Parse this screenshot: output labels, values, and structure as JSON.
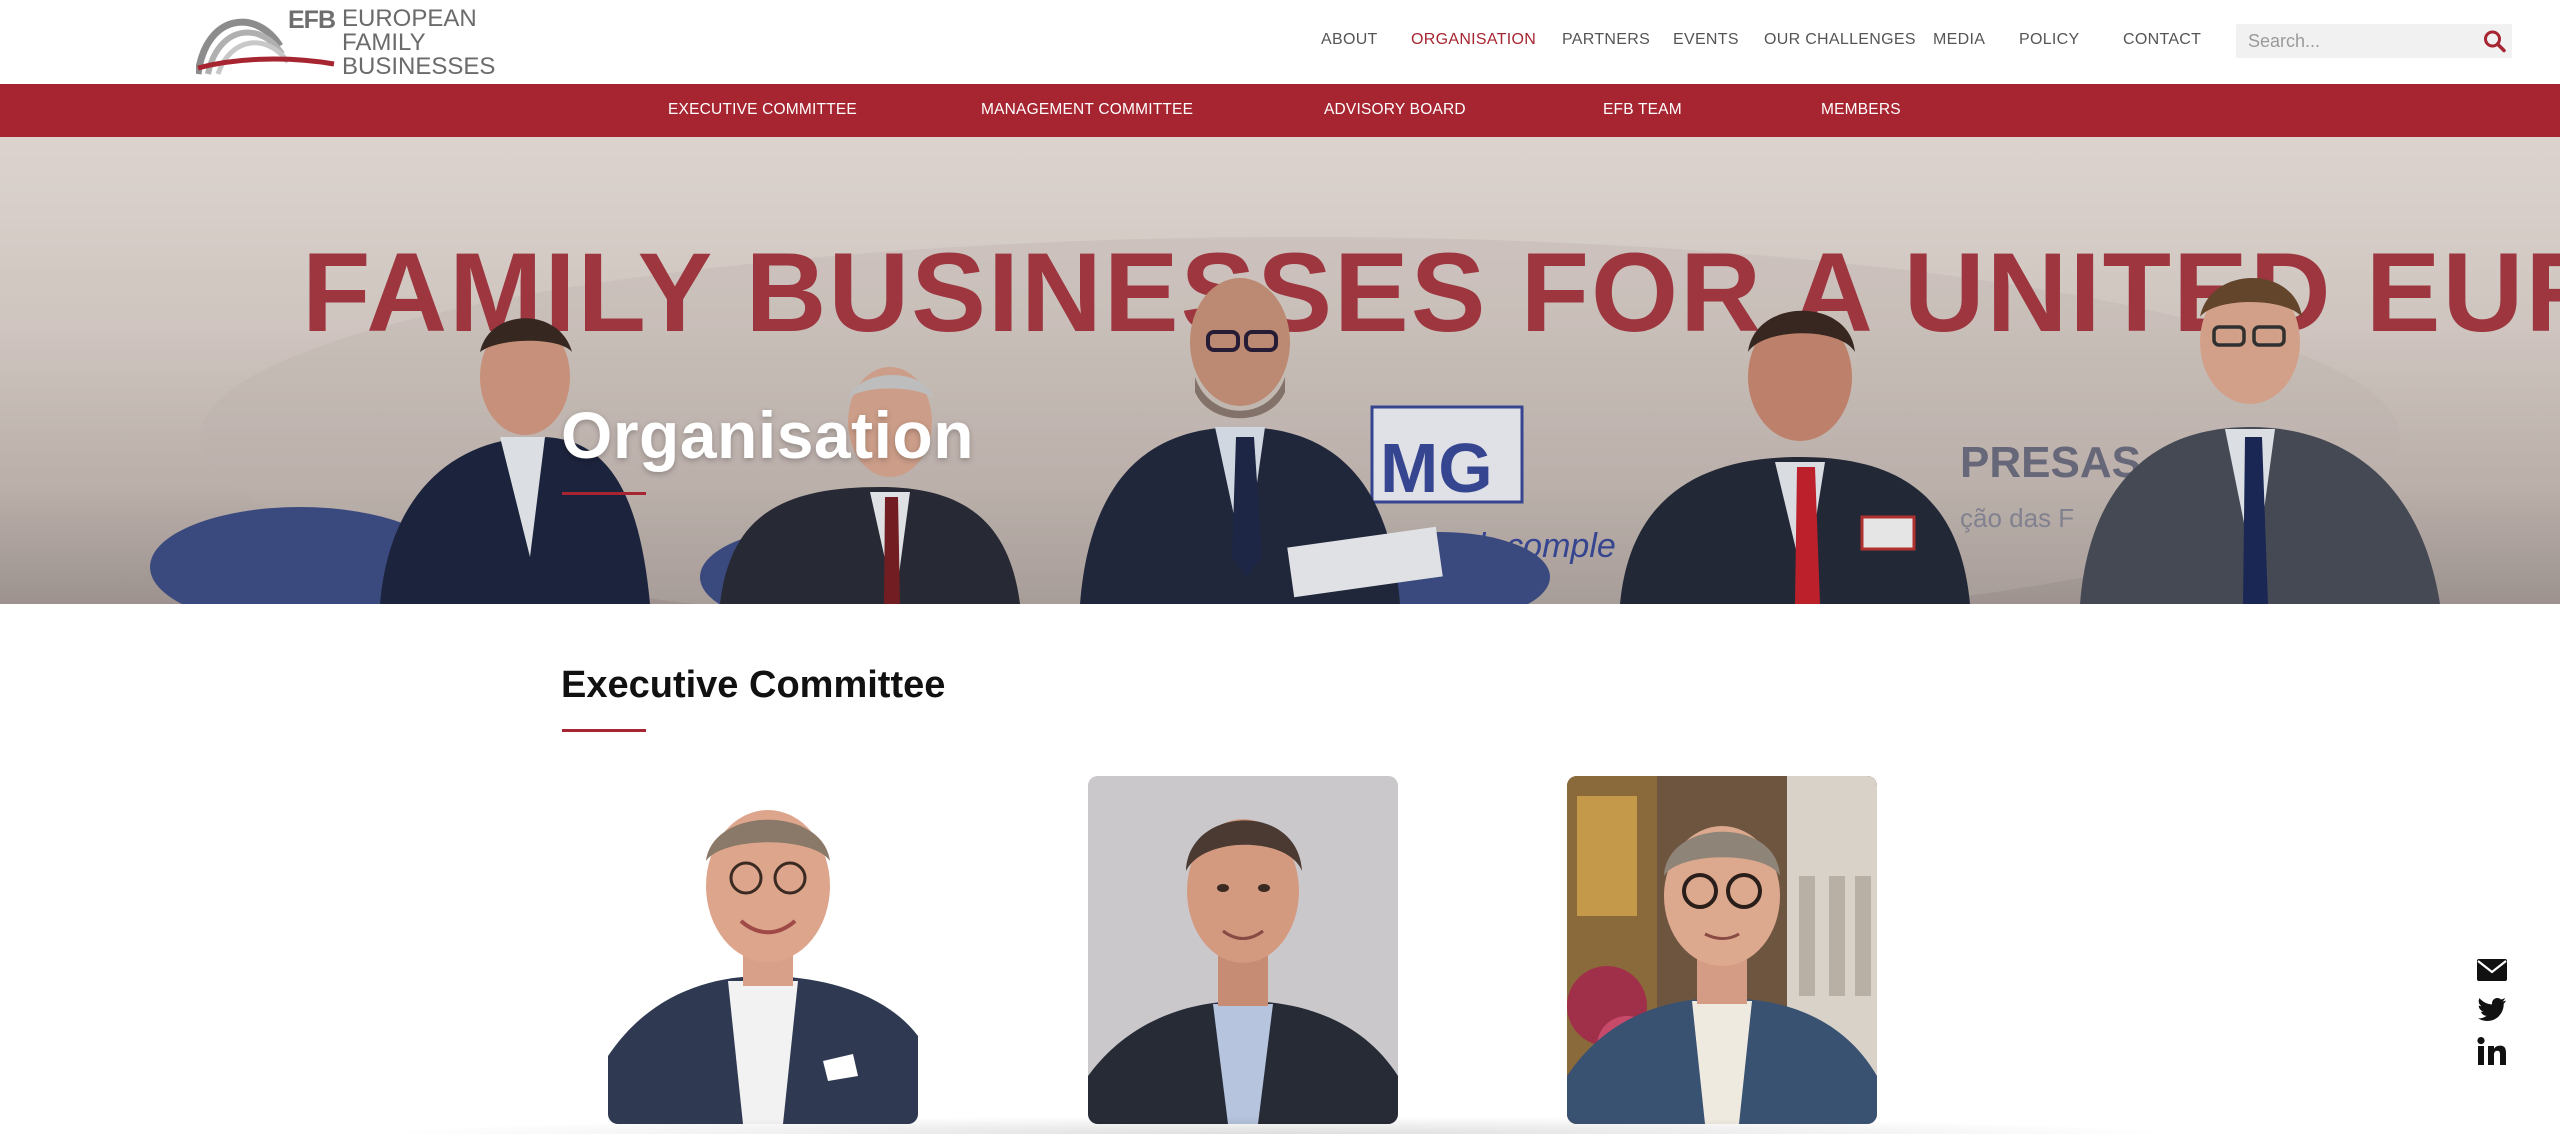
{
  "header": {
    "logo": {
      "abbr": "EFB",
      "line1": "EUROPEAN",
      "line2": "FAMILY",
      "line3": "BUSINESSES"
    },
    "nav": [
      {
        "label": "ABOUT",
        "active": false
      },
      {
        "label": "ORGANISATION",
        "active": true
      },
      {
        "label": "PARTNERS",
        "active": false
      },
      {
        "label": "EVENTS",
        "active": false
      },
      {
        "label": "OUR CHALLENGES",
        "active": false
      },
      {
        "label": "MEDIA",
        "active": false
      },
      {
        "label": "POLICY",
        "active": false
      },
      {
        "label": "CONTACT",
        "active": false
      }
    ],
    "search": {
      "placeholder": "Search...",
      "value": "",
      "icon": "search-icon"
    }
  },
  "subnav": [
    {
      "label": "EXECUTIVE COMMITTEE"
    },
    {
      "label": "MANAGEMENT COMMITTEE"
    },
    {
      "label": "ADVISORY BOARD"
    },
    {
      "label": "EFB TEAM"
    },
    {
      "label": "MEMBERS"
    }
  ],
  "hero": {
    "title": "Organisation",
    "banner_text": "FAMILY BUSINESSES FOR A UNITED EUROPE",
    "banner_fragments": [
      "MG",
      "ugh comple",
      "PRESAS",
      "ção das F"
    ]
  },
  "section": {
    "title": "Executive Committee",
    "members": [
      {
        "photo": "member-photo-1"
      },
      {
        "photo": "member-photo-2"
      },
      {
        "photo": "member-photo-3"
      }
    ]
  },
  "social": [
    {
      "icon": "envelope-icon"
    },
    {
      "icon": "twitter-icon"
    },
    {
      "icon": "linkedin-icon"
    }
  ],
  "colors": {
    "brand_red": "#a62531",
    "nav_text": "#555555",
    "search_bg": "#f1f1f1"
  }
}
